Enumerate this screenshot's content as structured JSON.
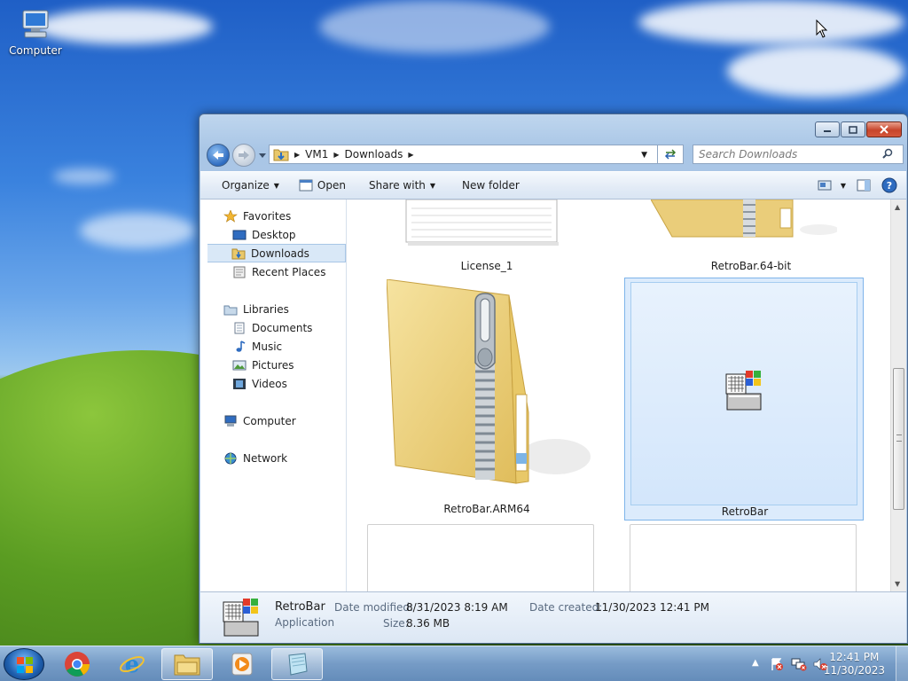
{
  "desktop": {
    "icons": [
      {
        "label": "Computer",
        "icon": "computer-icon"
      }
    ]
  },
  "window": {
    "breadcrumb": [
      "VM1",
      "Downloads"
    ],
    "search_placeholder": "Search Downloads",
    "toolbar": {
      "organize": "Organize",
      "open": "Open",
      "share_with": "Share with",
      "new_folder": "New folder"
    },
    "nav": {
      "favorites": "Favorites",
      "desktop": "Desktop",
      "downloads": "Downloads",
      "recent_places": "Recent Places",
      "libraries": "Libraries",
      "documents": "Documents",
      "music": "Music",
      "pictures": "Pictures",
      "videos": "Videos",
      "computer": "Computer",
      "network": "Network"
    },
    "files": [
      {
        "name": "License_1",
        "type": "document"
      },
      {
        "name": "RetroBar.64-bit",
        "type": "zip-folder"
      },
      {
        "name": "RetroBar.ARM64",
        "type": "zip-folder"
      },
      {
        "name": "RetroBar",
        "type": "application",
        "selected": true
      }
    ],
    "details": {
      "name": "RetroBar",
      "type": "Application",
      "date_modified_label": "Date modified:",
      "date_modified": "8/31/2023 8:19 AM",
      "date_created_label": "Date created:",
      "date_created": "11/30/2023 12:41 PM",
      "size_label": "Size:",
      "size": "8.36 MB"
    }
  },
  "taskbar": {
    "apps": [
      "chrome-icon",
      "ie-icon",
      "explorer-icon",
      "media-player-icon",
      "notepad-icon"
    ],
    "clock_time": "12:41 PM",
    "clock_date": "11/30/2023"
  }
}
